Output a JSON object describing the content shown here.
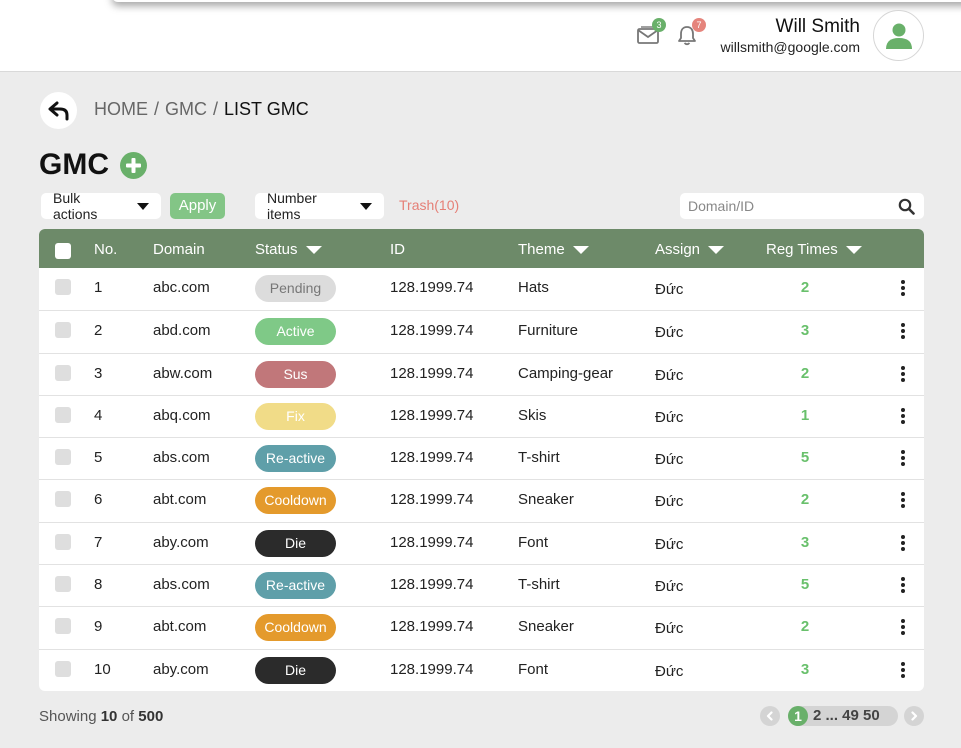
{
  "header": {
    "mail_badge": "3",
    "bell_badge": "7",
    "user_name": "Will Smith",
    "user_email": "willsmith@google.com"
  },
  "breadcrumb": {
    "home": "HOME",
    "section": "GMC",
    "current": "LIST GMC",
    "separator": "/"
  },
  "page": {
    "title": "GMC"
  },
  "toolbar": {
    "bulk_actions": "Bulk actions",
    "apply": "Apply",
    "number_items": "Number items",
    "trash": "Trash(10)",
    "search_placeholder": "Domain/ID"
  },
  "table": {
    "columns": {
      "no": "No.",
      "domain": "Domain",
      "status": "Status",
      "id": "ID",
      "theme": "Theme",
      "assign": "Assign",
      "reg_times": "Reg Times"
    },
    "rows": [
      {
        "no": "1",
        "domain": "abc.com",
        "status": "Pending",
        "id": "128.1999.74",
        "theme": "Hats",
        "assign": "Đức",
        "reg_times": "2"
      },
      {
        "no": "2",
        "domain": "abd.com",
        "status": "Active",
        "id": "128.1999.74",
        "theme": "Furniture",
        "assign": "Đức",
        "reg_times": "3"
      },
      {
        "no": "3",
        "domain": "abw.com",
        "status": "Sus",
        "id": "128.1999.74",
        "theme": "Camping-gear",
        "assign": "Đức",
        "reg_times": "2"
      },
      {
        "no": "4",
        "domain": "abq.com",
        "status": "Fix",
        "id": "128.1999.74",
        "theme": "Skis",
        "assign": "Đức",
        "reg_times": "1"
      },
      {
        "no": "5",
        "domain": "abs.com",
        "status": "Re-active",
        "id": "128.1999.74",
        "theme": "T-shirt",
        "assign": "Đức",
        "reg_times": "5"
      },
      {
        "no": "6",
        "domain": "abt.com",
        "status": "Cooldown",
        "id": "128.1999.74",
        "theme": "Sneaker",
        "assign": "Đức",
        "reg_times": "2"
      },
      {
        "no": "7",
        "domain": "aby.com",
        "status": "Die",
        "id": "128.1999.74",
        "theme": "Font",
        "assign": "Đức",
        "reg_times": "3"
      },
      {
        "no": "8",
        "domain": "abs.com",
        "status": "Re-active",
        "id": "128.1999.74",
        "theme": "T-shirt",
        "assign": "Đức",
        "reg_times": "5"
      },
      {
        "no": "9",
        "domain": "abt.com",
        "status": "Cooldown",
        "id": "128.1999.74",
        "theme": "Sneaker",
        "assign": "Đức",
        "reg_times": "2"
      },
      {
        "no": "10",
        "domain": "aby.com",
        "status": "Die",
        "id": "128.1999.74",
        "theme": "Font",
        "assign": "Đức",
        "reg_times": "3"
      }
    ]
  },
  "status_colors": {
    "Pending": {
      "bg": "#dcdcdc",
      "fg": "#777777"
    },
    "Active": {
      "bg": "#7fc987",
      "fg": "#ffffff"
    },
    "Sus": {
      "bg": "#c1777a",
      "fg": "#ffffff"
    },
    "Fix": {
      "bg": "#f1dc88",
      "fg": "#ffffff"
    },
    "Re-active": {
      "bg": "#5f9fa9",
      "fg": "#ffffff"
    },
    "Cooldown": {
      "bg": "#e49a2c",
      "fg": "#ffffff"
    },
    "Die": {
      "bg": "#2b2b2b",
      "fg": "#ffffff"
    }
  },
  "footer": {
    "showing_label": "Showing",
    "showing_count": "10",
    "of_label": "of",
    "total": "500",
    "current_page": "1",
    "other_pages": "2 ... 49 50"
  },
  "colors": {
    "accent": "#69b06a",
    "table_header": "#6d8a69",
    "trash": "#e57f76",
    "reg_times": "#69c06c"
  },
  "icons": [
    "mail-icon",
    "bell-icon",
    "user-icon",
    "back-arrow-icon",
    "plus-icon",
    "caret-down-icon",
    "search-icon",
    "kebab-menu-icon",
    "chevron-left-icon",
    "chevron-right-icon"
  ]
}
